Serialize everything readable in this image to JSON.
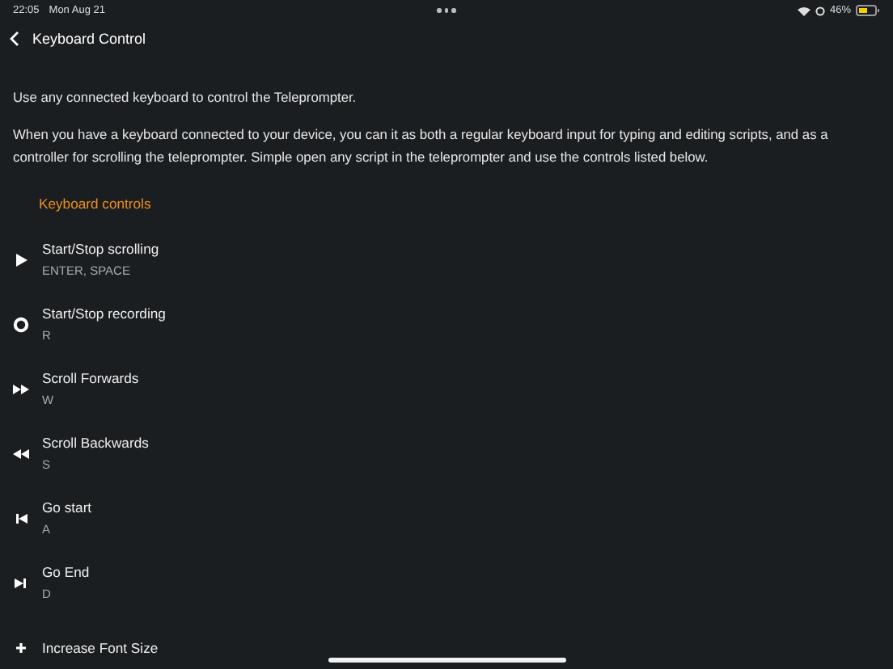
{
  "status_bar": {
    "time": "22:05",
    "date": "Mon Aug 21",
    "battery": "46%"
  },
  "nav": {
    "title": "Keyboard Control"
  },
  "intro": "Use any connected keyboard to control the Teleprompter.",
  "description": "When you have a keyboard connected to your device, you can it as both a regular keyboard input for typing and editing scripts, and as a controller for scrolling the teleprompter. Simple open any script in the teleprompter and use the controls listed below.",
  "section_title": "Keyboard controls",
  "controls": [
    {
      "kind": "play",
      "title": "Start/Stop scrolling",
      "keys": "ENTER, SPACE"
    },
    {
      "kind": "record",
      "title": "Start/Stop recording",
      "keys": "R"
    },
    {
      "kind": "forward",
      "title": "Scroll Forwards",
      "keys": "W"
    },
    {
      "kind": "backward",
      "title": "Scroll Backwards",
      "keys": "S"
    },
    {
      "kind": "start",
      "title": "Go start",
      "keys": "A"
    },
    {
      "kind": "end",
      "title": "Go End",
      "keys": "D"
    },
    {
      "kind": "font",
      "title": "Increase Font Size"
    }
  ]
}
